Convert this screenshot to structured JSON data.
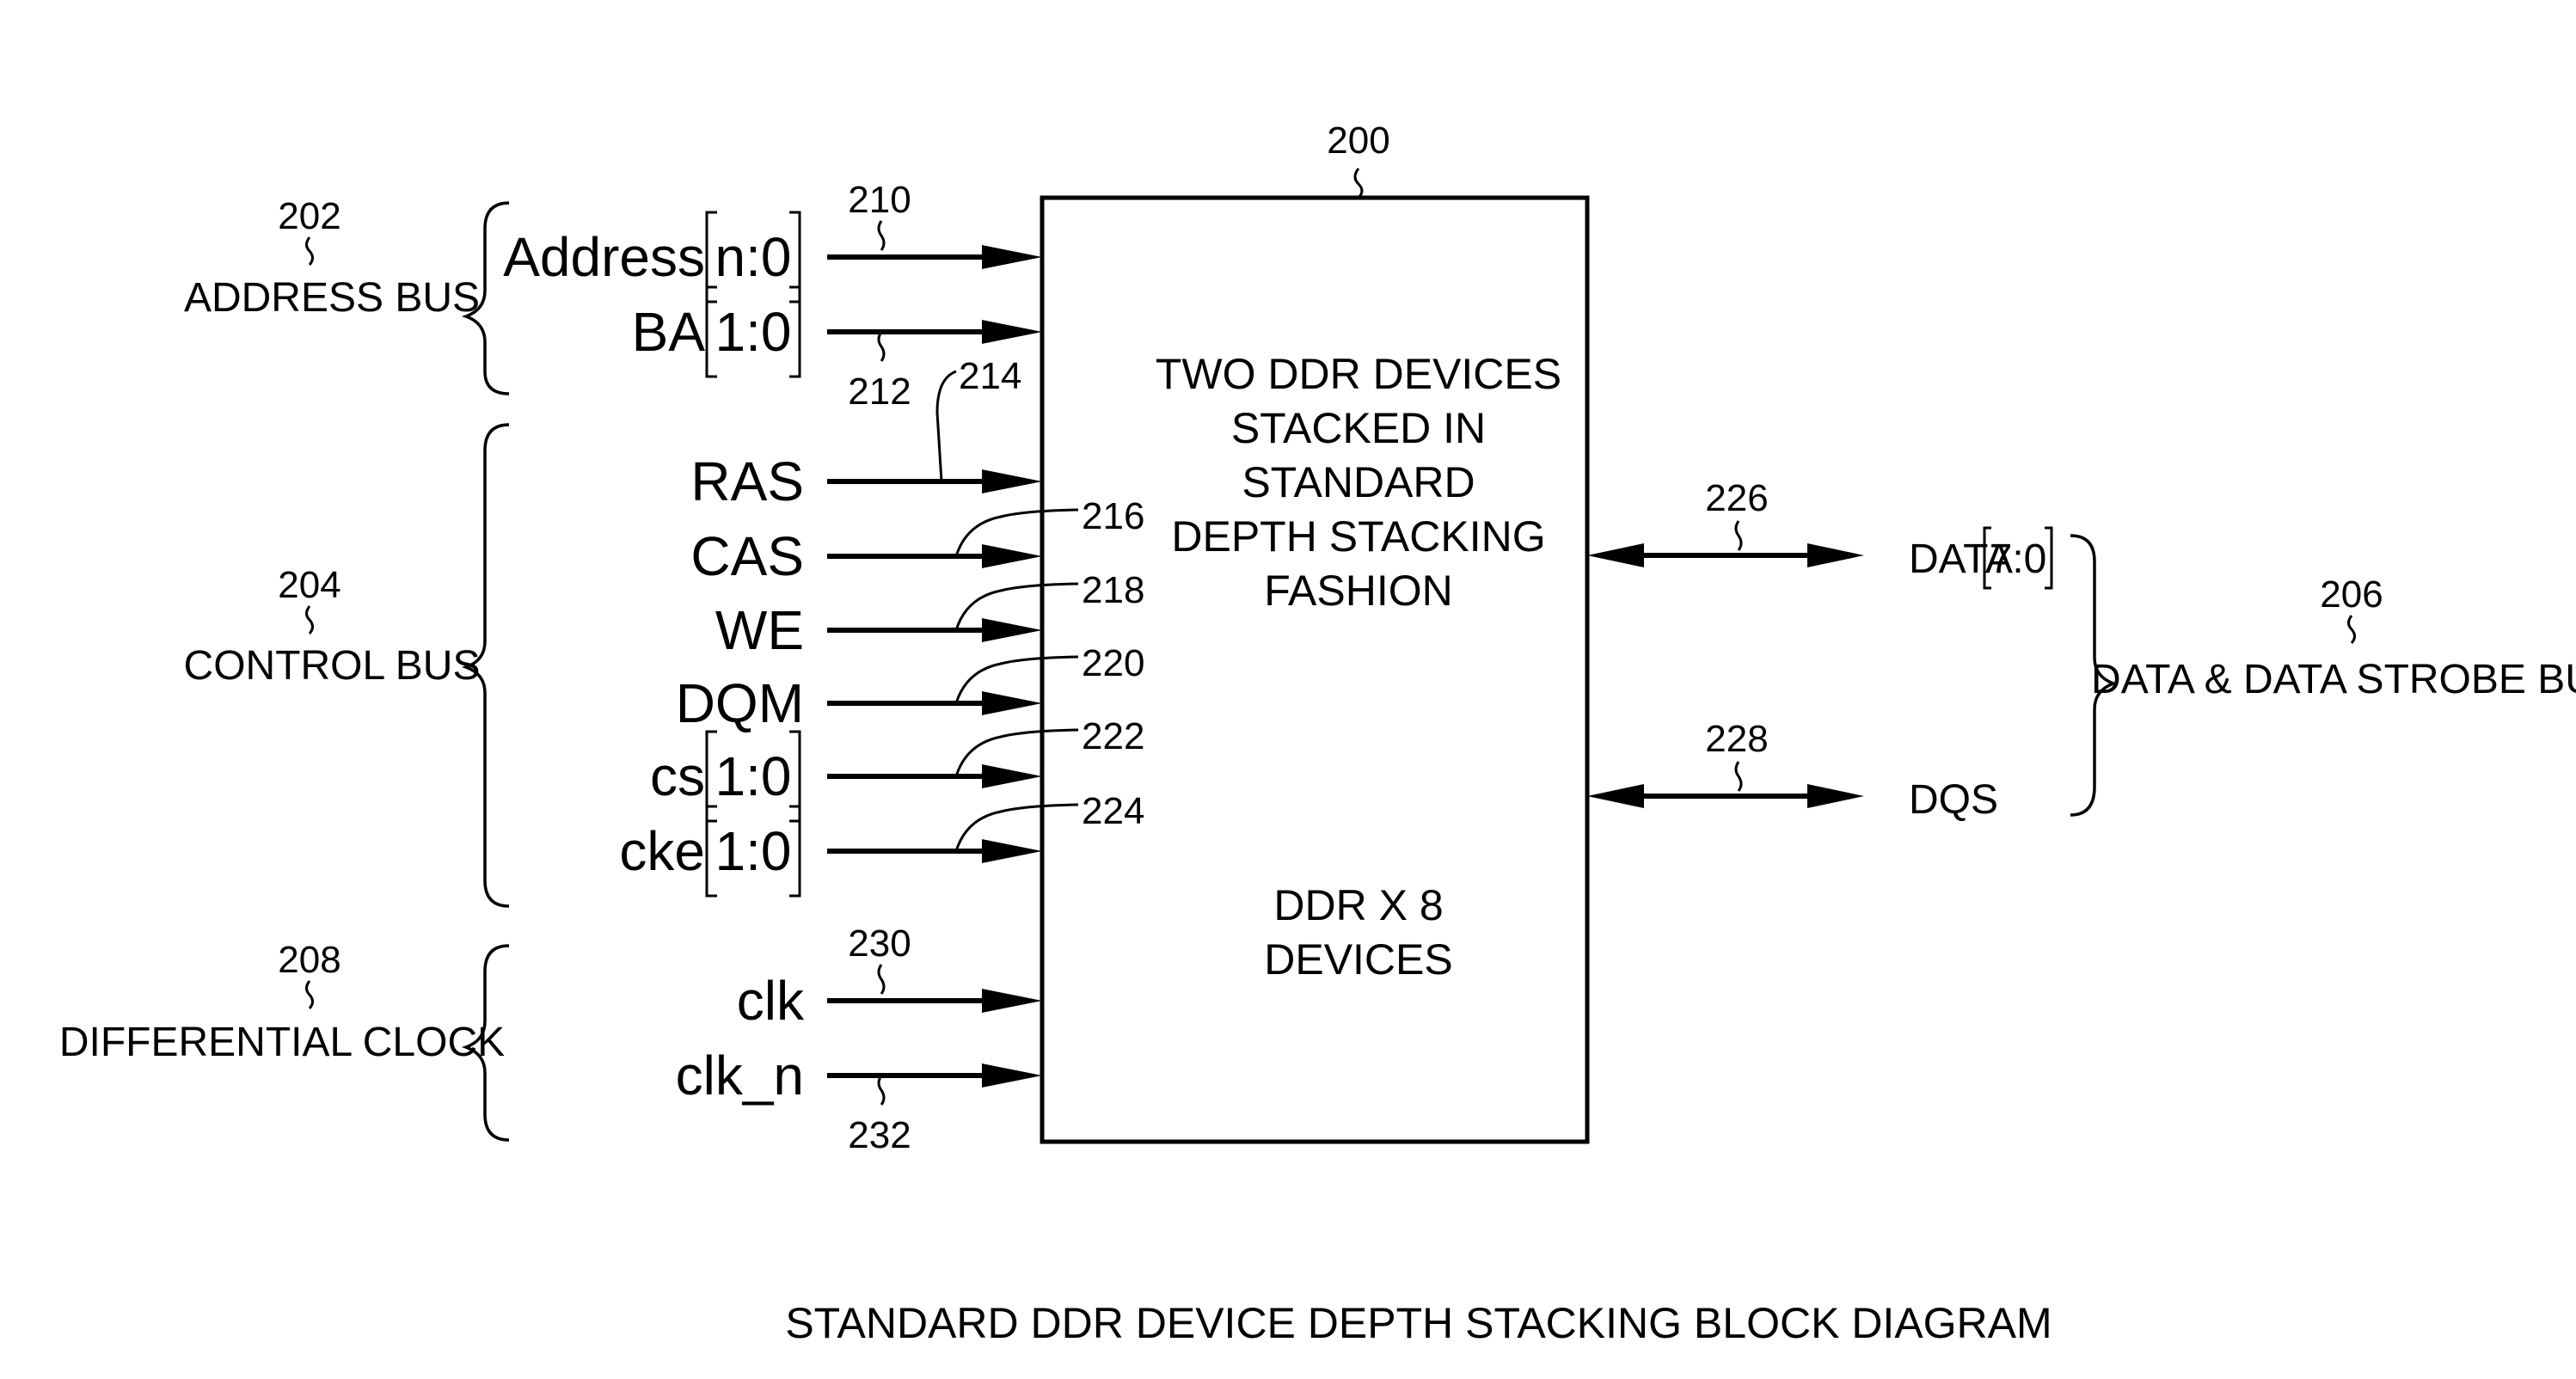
{
  "diagram": {
    "caption": "STANDARD DDR DEVICE DEPTH STACKING BLOCK DIAGRAM",
    "block": {
      "ref": "200",
      "text_top": [
        "TWO DDR DEVICES",
        "STACKED IN",
        "STANDARD",
        "DEPTH STACKING",
        "FASHION"
      ],
      "text_bottom": [
        "DDR X 8",
        "DEVICES"
      ]
    },
    "groups": [
      {
        "id": "address",
        "ref": "202",
        "label": "ADDRESS BUS",
        "side": "left"
      },
      {
        "id": "control",
        "ref": "204",
        "label": "CONTROL BUS",
        "side": "left"
      },
      {
        "id": "clock",
        "ref": "208",
        "label": "DIFFERENTIAL CLOCK",
        "side": "left"
      },
      {
        "id": "data",
        "ref": "206",
        "label": "DATA & DATA STROBE BUS",
        "side": "right"
      }
    ],
    "inputs": [
      {
        "name": "Address",
        "range": "n:0",
        "ref": "210",
        "group": "address",
        "direction": "in"
      },
      {
        "name": "BA",
        "range": "1:0",
        "ref": "212",
        "group": "address",
        "direction": "in"
      },
      {
        "name": "RAS",
        "range": "",
        "ref": "214",
        "group": "control",
        "direction": "in"
      },
      {
        "name": "CAS",
        "range": "",
        "ref": "216",
        "group": "control",
        "direction": "in"
      },
      {
        "name": "WE",
        "range": "",
        "ref": "218",
        "group": "control",
        "direction": "in"
      },
      {
        "name": "DQM",
        "range": "",
        "ref": "220",
        "group": "control",
        "direction": "in"
      },
      {
        "name": "cs",
        "range": "1:0",
        "ref": "222",
        "group": "control",
        "direction": "in"
      },
      {
        "name": "cke",
        "range": "1:0",
        "ref": "224",
        "group": "control",
        "direction": "in"
      },
      {
        "name": "clk",
        "range": "",
        "ref": "230",
        "group": "clock",
        "direction": "in"
      },
      {
        "name": "clk_n",
        "range": "",
        "ref": "232",
        "group": "clock",
        "direction": "in"
      }
    ],
    "outputs": [
      {
        "name": "DATA",
        "range": "7:0",
        "ref": "226",
        "group": "data",
        "direction": "bidirectional"
      },
      {
        "name": "DQS",
        "range": "",
        "ref": "228",
        "group": "data",
        "direction": "bidirectional"
      }
    ]
  }
}
